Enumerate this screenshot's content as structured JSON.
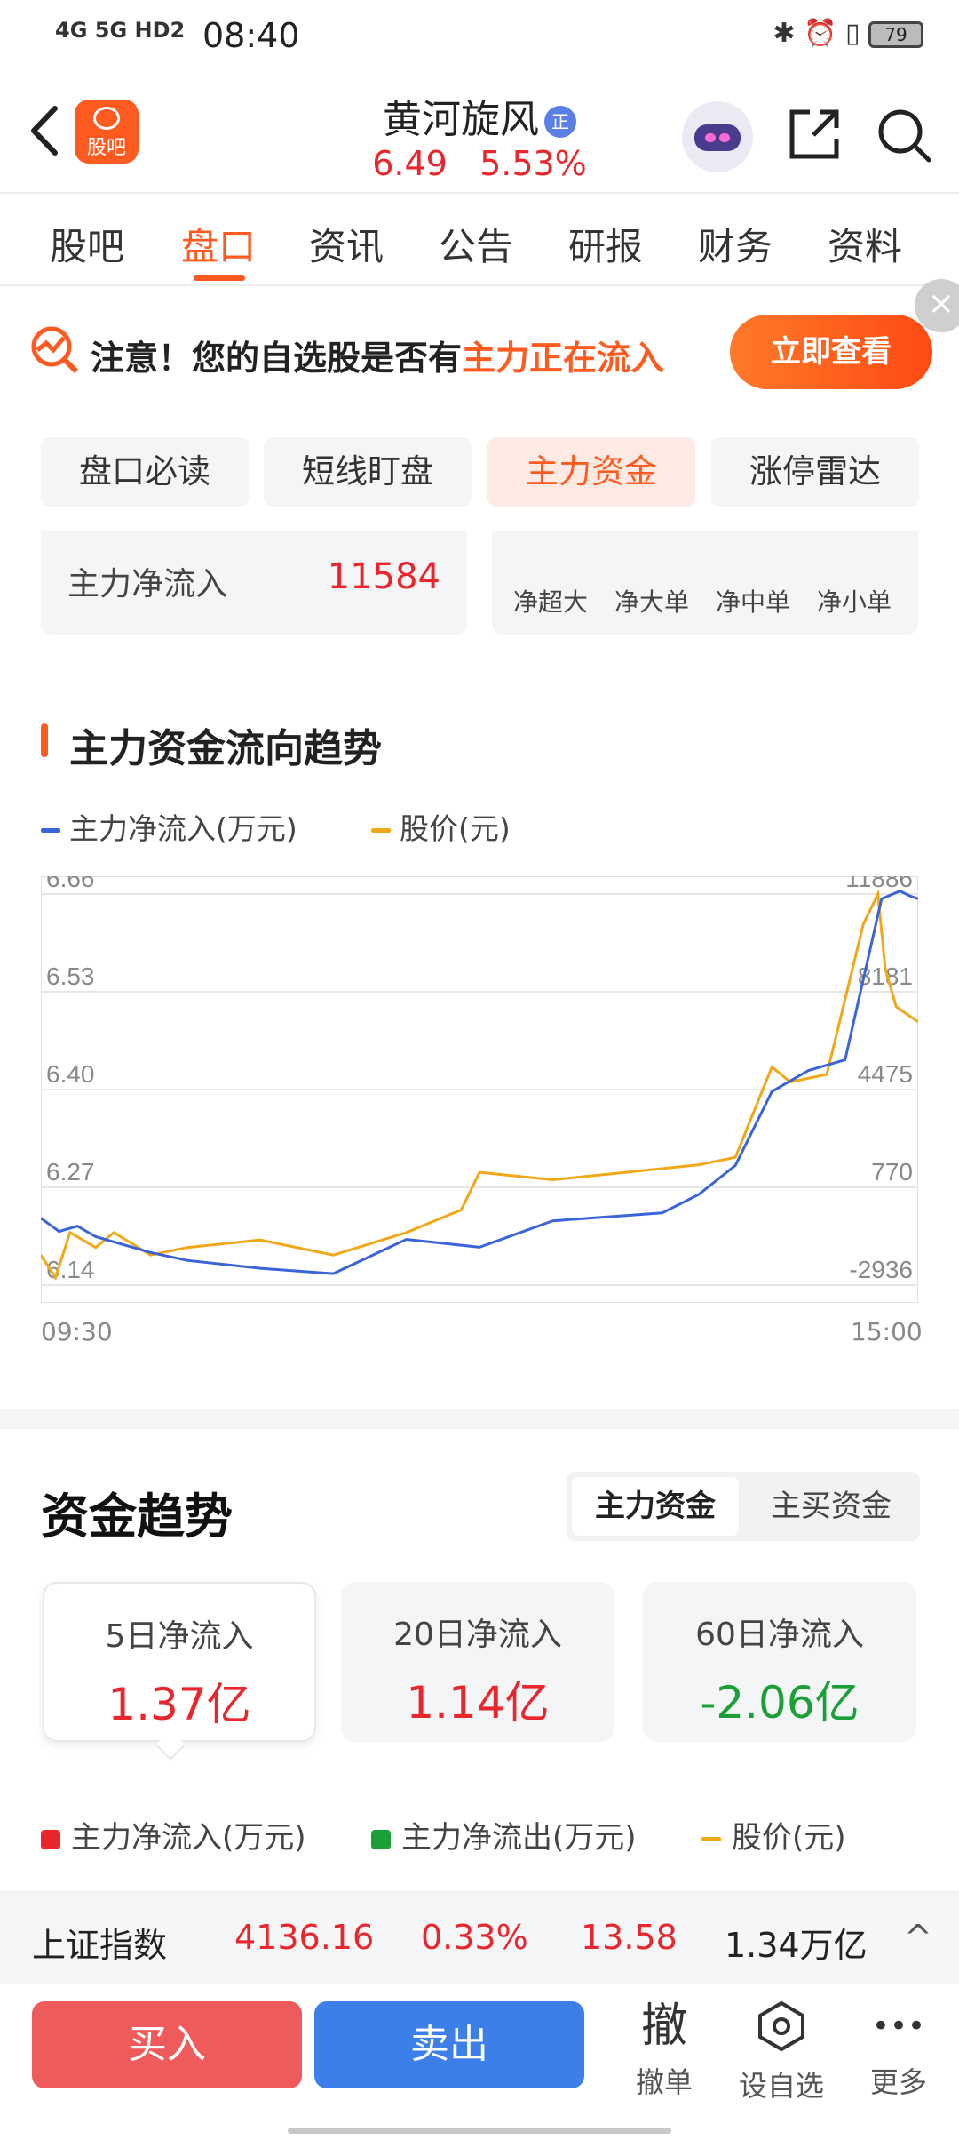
{
  "status_bar": {
    "network": "4G 5G HD2",
    "time": "08:40",
    "battery": "79"
  },
  "header": {
    "logo_label": "股吧",
    "stock_name": "黄河旋风",
    "badge": "正",
    "price": "6.49",
    "change_pct": "5.53%"
  },
  "tabs": [
    "股吧",
    "盘口",
    "资讯",
    "公告",
    "研报",
    "财务",
    "资料"
  ],
  "alert": {
    "prefix": "注意！您的自选股是否有",
    "highlight": "主力正在流入",
    "button": "立即查看",
    "close": "×"
  },
  "segments": [
    "盘口必读",
    "短线盯盘",
    "主力资金",
    "涨停雷达"
  ],
  "flow_summary": {
    "label": "主力净流入",
    "value": "11584",
    "columns": [
      "净超大",
      "净大单",
      "净中单",
      "净小单"
    ]
  },
  "section_title": "主力资金流向趋势",
  "legend": {
    "net_inflow": "主力净流入(万元)",
    "price": "股价(元)"
  },
  "colors": {
    "accent": "#ff5a1f",
    "up": "#e8262b",
    "down": "#1aa036",
    "net_line": "#3b64d8",
    "price_line": "#f0a818"
  },
  "chart_data": {
    "type": "line",
    "x_start": "09:30",
    "x_end": "15:00",
    "y_left_ticks": [
      "6.66",
      "6.53",
      "6.40",
      "6.27",
      "6.14"
    ],
    "y_right_ticks": [
      "11886",
      "8181",
      "4475",
      "770",
      "-2936"
    ],
    "y_left_range": [
      6.14,
      6.66
    ],
    "y_right_range": [
      -2936,
      11886
    ],
    "series": [
      {
        "name": "主力净流入(万元)",
        "x": [
          0,
          5,
          10,
          15,
          20,
          30,
          40,
          60,
          80,
          100,
          120,
          140,
          160,
          170,
          180,
          190,
          200,
          210,
          220,
          230,
          235,
          238,
          240
        ],
        "values": [
          -400,
          -900,
          -700,
          -1100,
          -1300,
          -1700,
          -2000,
          -2300,
          -2500,
          -1200,
          -1500,
          -500,
          -300,
          -200,
          500,
          1600,
          4400,
          5200,
          5600,
          11700,
          12000,
          11800,
          11700
        ]
      },
      {
        "name": "股价(元)",
        "x": [
          0,
          4,
          8,
          15,
          20,
          30,
          40,
          60,
          80,
          100,
          115,
          120,
          140,
          160,
          180,
          190,
          200,
          205,
          215,
          225,
          229,
          231,
          234,
          240
        ],
        "values": [
          6.18,
          6.15,
          6.21,
          6.19,
          6.21,
          6.18,
          6.19,
          6.2,
          6.18,
          6.21,
          6.24,
          6.29,
          6.28,
          6.29,
          6.3,
          6.31,
          6.43,
          6.41,
          6.42,
          6.62,
          6.66,
          6.56,
          6.51,
          6.49
        ]
      }
    ]
  },
  "trend": {
    "title": "资金趋势",
    "toggle": [
      "主力资金",
      "主买资金"
    ],
    "boxes": [
      {
        "label": "5日净流入",
        "value": "1.37亿"
      },
      {
        "label": "20日净流入",
        "value": "1.14亿"
      },
      {
        "label": "60日净流入",
        "value": "-2.06亿"
      }
    ],
    "legend": [
      "主力净流入(万元)",
      "主力净流出(万元)",
      "股价(元)"
    ]
  },
  "index_bar": {
    "name": "上证指数",
    "value": "4136.16",
    "pct": "0.33%",
    "change": "13.58",
    "volume": "1.34万亿",
    "chevron": "^"
  },
  "actions": {
    "buy": "买入",
    "sell": "卖出",
    "cancel_icon": "撤",
    "cancel": "撤单",
    "watch": "设自选",
    "more_icon": "•••",
    "more": "更多"
  }
}
